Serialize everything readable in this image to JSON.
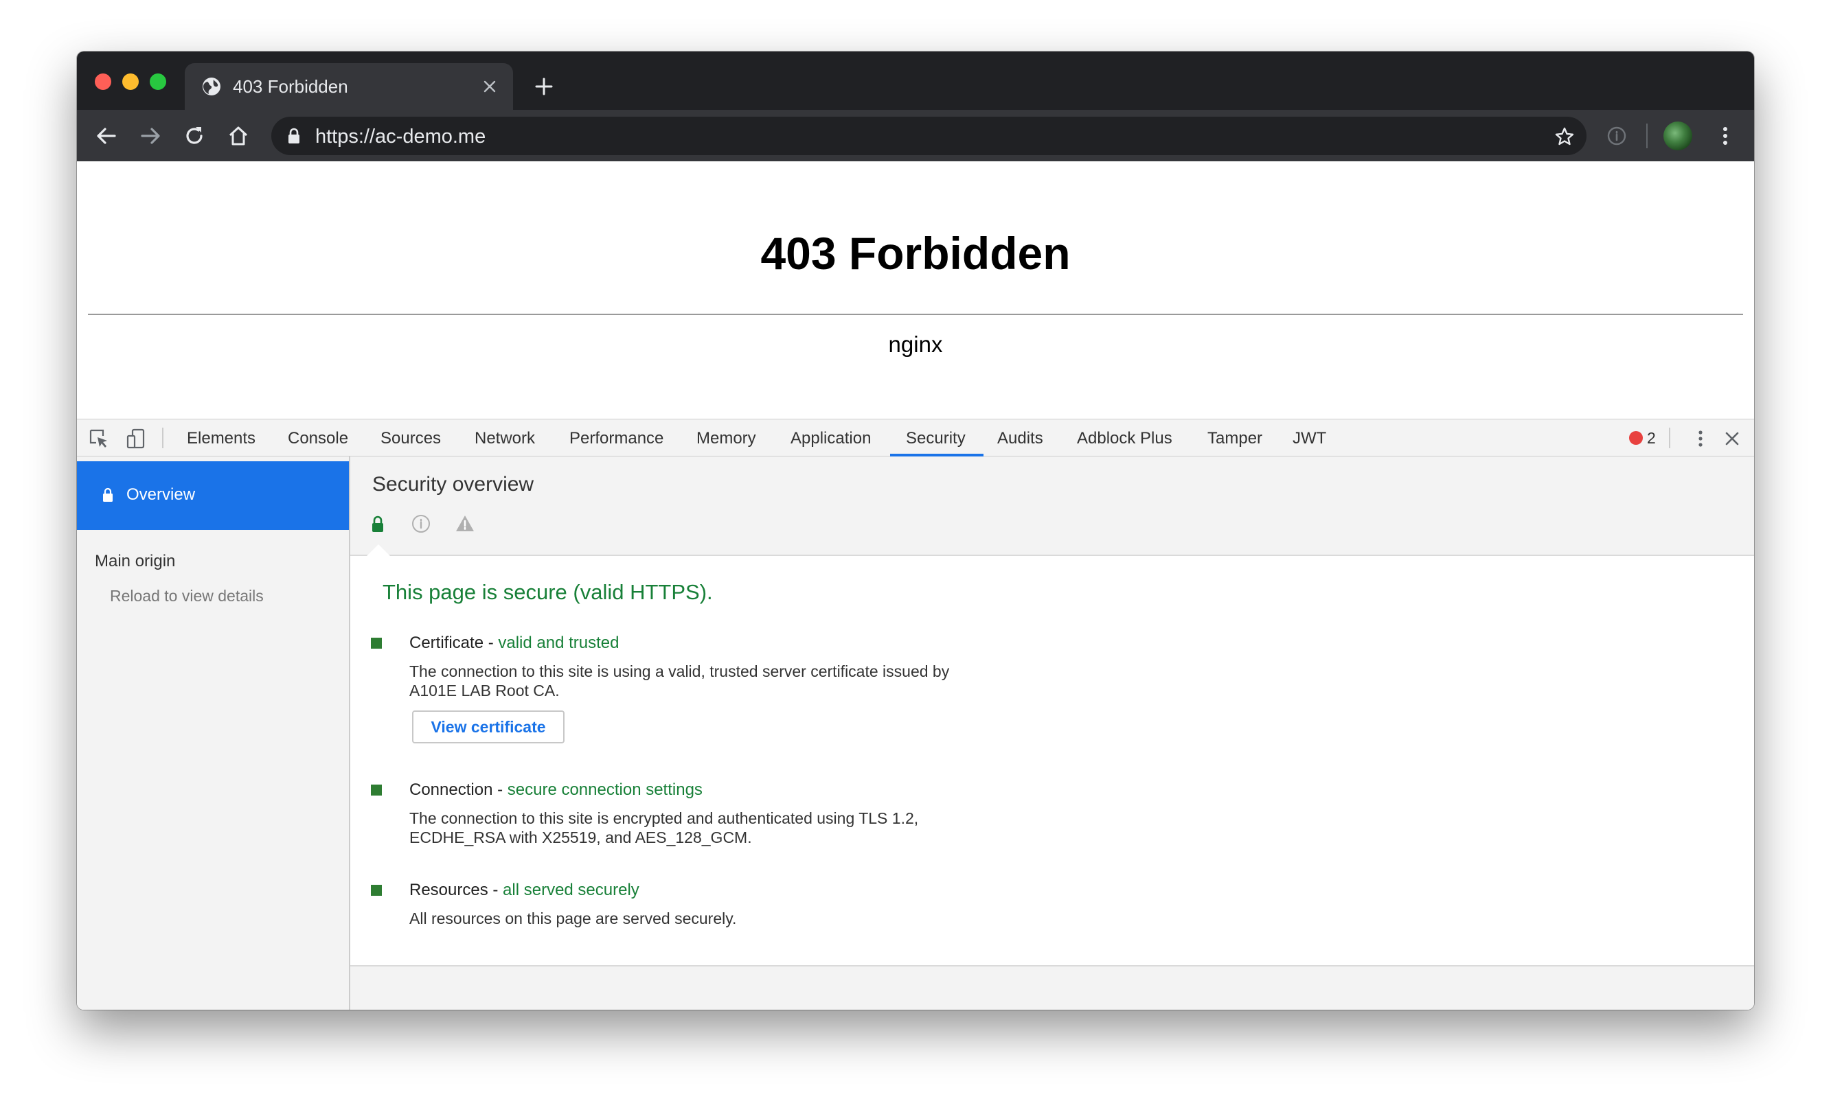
{
  "browser": {
    "tab": {
      "title": "403 Forbidden",
      "favicon": "globe-icon",
      "close_icon": "close-icon"
    },
    "new_tab_icon": "plus-icon",
    "toolbar": {
      "back_icon": "back-arrow-icon",
      "forward_icon": "forward-arrow-icon",
      "reload_icon": "reload-icon",
      "home_icon": "home-icon",
      "url_scheme": "https://",
      "url_host": "ac-demo.me",
      "lock_icon": "lock-icon",
      "star_icon": "star-icon",
      "extension_icon": "info-icon",
      "menu_icon": "kebab-menu-icon"
    }
  },
  "page": {
    "title": "403 Forbidden",
    "server": "nginx"
  },
  "devtools": {
    "tabs": [
      "Elements",
      "Console",
      "Sources",
      "Network",
      "Performance",
      "Memory",
      "Application",
      "Security",
      "Audits",
      "Adblock Plus",
      "Tamper",
      "JWT"
    ],
    "active_tab": "Security",
    "error_count": "2",
    "sidebar": {
      "overview_label": "Overview",
      "main_origin_label": "Main origin",
      "reload_label": "Reload to view details"
    },
    "security": {
      "title": "Security overview",
      "summary": "This page is secure (valid HTTPS).",
      "items": [
        {
          "name": "Certificate",
          "sep": " - ",
          "status": "valid and trusted",
          "description": "The connection to this site is using a valid, trusted server certificate issued by A101E LAB Root CA.",
          "button": "View certificate"
        },
        {
          "name": "Connection",
          "sep": " - ",
          "status": "secure connection settings",
          "description": "The connection to this site is encrypted and authenticated using TLS 1.2, ECDHE_RSA with X25519, and AES_128_GCM."
        },
        {
          "name": "Resources",
          "sep": " - ",
          "status": "all served securely",
          "description": "All resources on this page are served securely."
        }
      ]
    }
  },
  "colors": {
    "accent": "#1a73e8",
    "secure_green": "#188038",
    "error_red": "#e8413f"
  }
}
